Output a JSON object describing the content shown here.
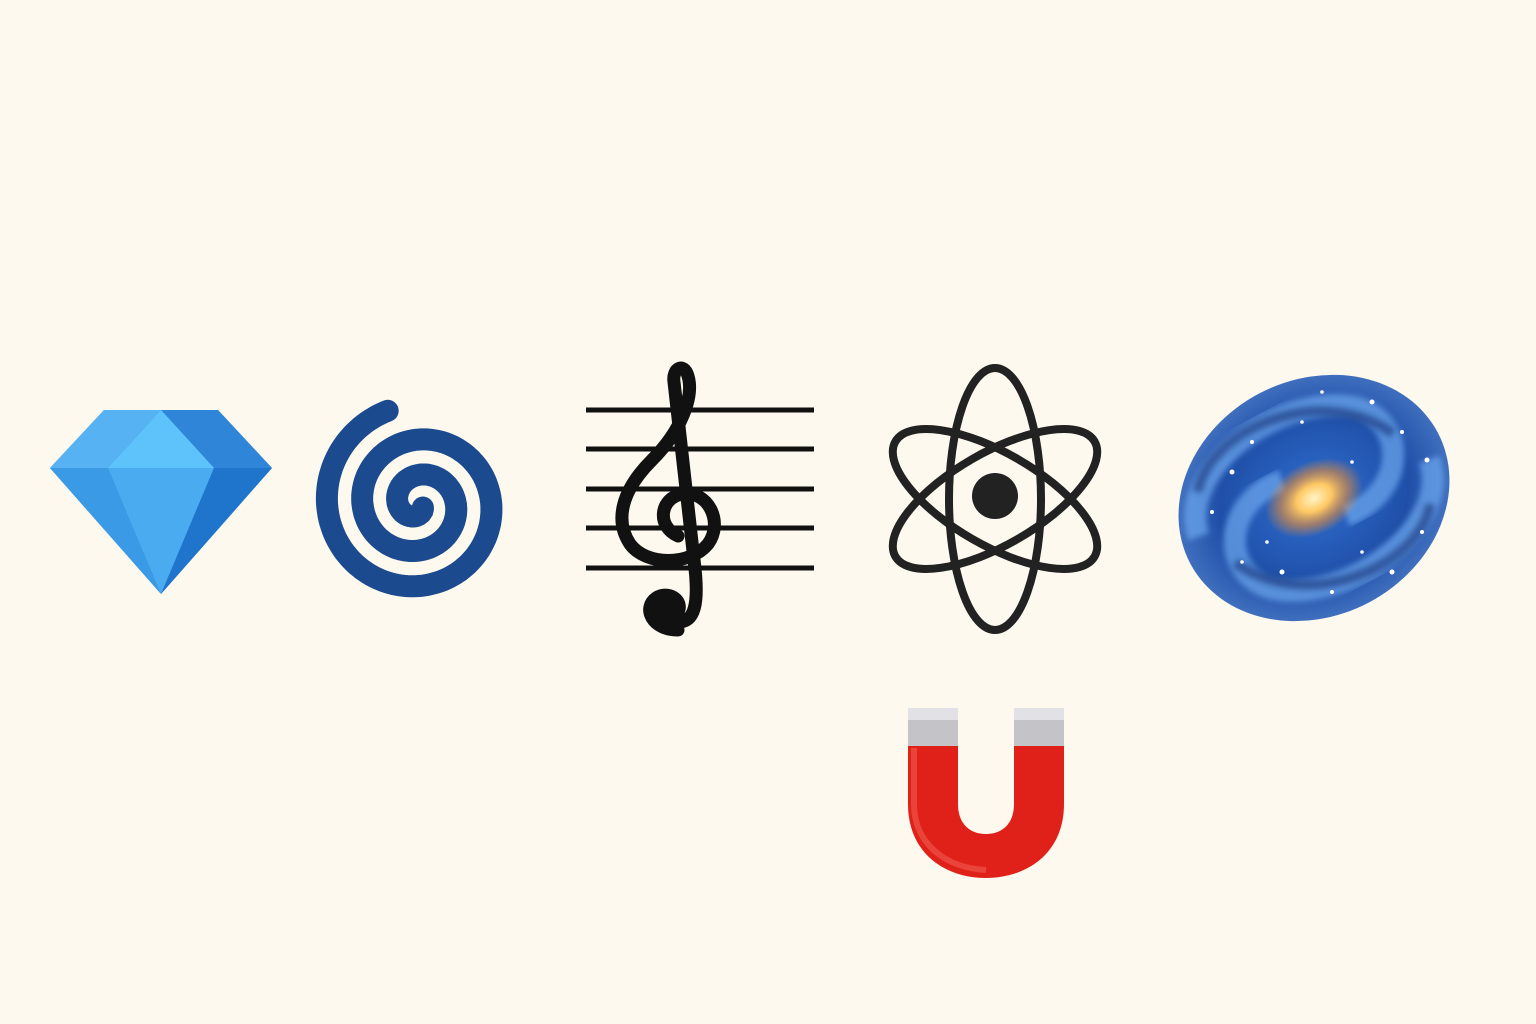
{
  "icons": [
    {
      "name": "diamond-icon",
      "color": "#3a9be8"
    },
    {
      "name": "spiral-icon",
      "color": "#1a4a8e"
    },
    {
      "name": "treble-clef-icon",
      "color": "#111111"
    },
    {
      "name": "atom-icon",
      "color": "#222222"
    },
    {
      "name": "galaxy-icon",
      "color": "#2a64c8"
    },
    {
      "name": "magnet-icon",
      "color": "#e0211a"
    }
  ],
  "background": "#fdf9ee"
}
